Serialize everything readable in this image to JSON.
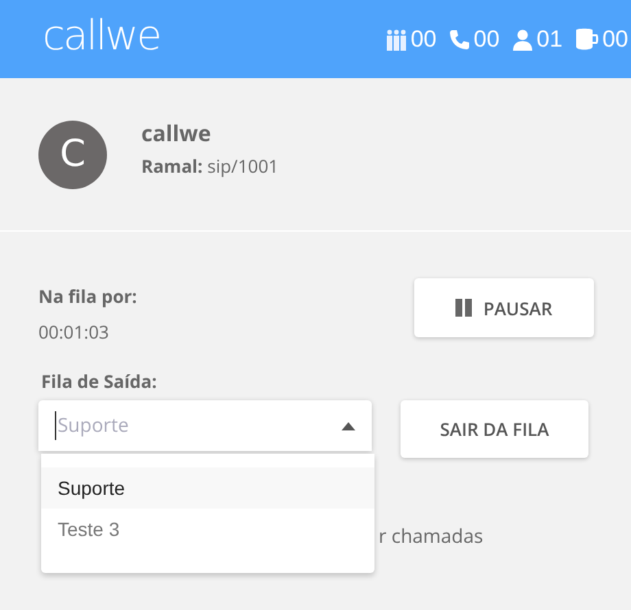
{
  "header": {
    "logo": "callwe",
    "counters": [
      {
        "kind": "group",
        "value": "00"
      },
      {
        "kind": "phone",
        "value": "00"
      },
      {
        "kind": "user",
        "value": "01"
      },
      {
        "kind": "mug",
        "value": "00"
      }
    ]
  },
  "profile": {
    "avatar": "C",
    "name": "callwe",
    "extension_label": "Ramal:",
    "extension": "sip/1001"
  },
  "queue": {
    "label": "Na fila por:",
    "time": "00:01:03",
    "pause_button": "PAUSAR"
  },
  "exit_queue": {
    "label": "Fila de Saída:",
    "placeholder": "Suporte",
    "expanded": true,
    "options": [
      {
        "label": "Suporte",
        "selected": true
      },
      {
        "label": "Teste 3",
        "selected": false
      }
    ],
    "button": "SAIR DA FILA"
  },
  "partial_text": "r chamadas"
}
